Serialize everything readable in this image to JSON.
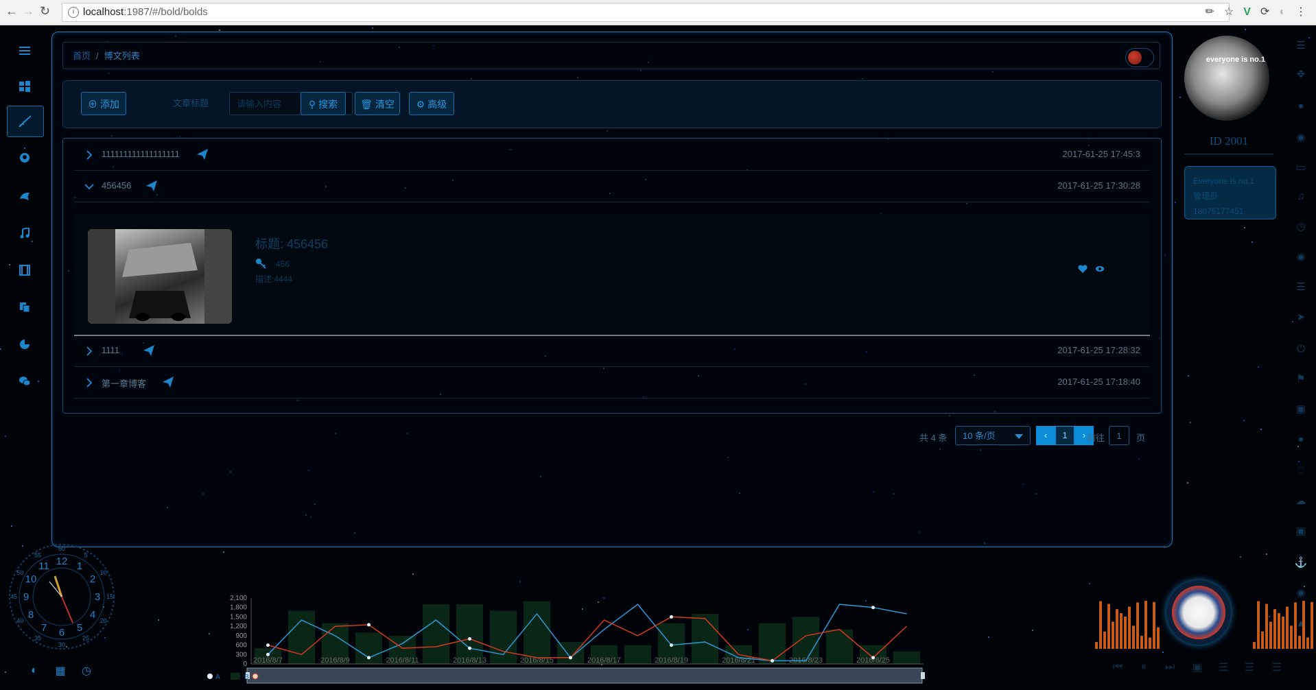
{
  "browser": {
    "url_host": "localhost",
    "url_rest": ":1987/#/bold/bolds"
  },
  "breadcrumb": {
    "home": "首页",
    "separator": "/",
    "current": "博文列表"
  },
  "toolbar": {
    "add_label": "添加",
    "field_label": "文章标题",
    "search_placeholder": "请输入内容",
    "search_label": "搜索",
    "clear_label": "清空",
    "advanced_label": "高级"
  },
  "posts": [
    {
      "title": "111111111111111111",
      "date": "2017-61-25 17:45:3",
      "expanded": false
    },
    {
      "title": "456456",
      "date": "2017-61-25 17:30:28",
      "expanded": true
    },
    {
      "title": "1111",
      "date": "2017-61-25 17:28:32",
      "expanded": false
    },
    {
      "title": "第一章博客",
      "date": "2017-61-25 17:18:40",
      "expanded": false
    }
  ],
  "detail": {
    "title": "标题: 456456",
    "tag": "456",
    "desc": "描述:4444"
  },
  "pagination": {
    "total": "共 4 条",
    "page_size": "10 条/页",
    "current_page": "1",
    "goto_label": "前往",
    "goto_value": "1",
    "page_unit": "页"
  },
  "profile": {
    "avatar_brand": "everyone is no.1",
    "id": "ID 2001",
    "motto": "Everyone is no.1",
    "role": "管理员",
    "phone": "18075177451"
  },
  "clock": {
    "center_digits": "12",
    "hour_numerals": [
      "12",
      "1",
      "2",
      "3",
      "4",
      "5",
      "6",
      "7",
      "8",
      "9",
      "10",
      "11"
    ],
    "minute_numerals": [
      "60",
      "5",
      "10",
      "15",
      "20",
      "25",
      "30",
      "35",
      "40",
      "45",
      "50",
      "55"
    ]
  },
  "colors": {
    "accent": "#1b86cc",
    "series_a": "#2a9ad8",
    "series_b": "#d8391c",
    "bars": "#0b2a1a"
  },
  "chart_data": {
    "type": "line",
    "categories": [
      "2016/8/7",
      "2016/8/8",
      "2016/8/9",
      "2016/8/10",
      "2016/8/11",
      "2016/8/12",
      "2016/8/13",
      "2016/8/14",
      "2016/8/15",
      "2016/8/16",
      "2016/8/17",
      "2016/8/18",
      "2016/8/19",
      "2016/8/20",
      "2016/8/21",
      "2016/8/22",
      "2016/8/23",
      "2016/8/24",
      "2016/8/25",
      "2016/8/26"
    ],
    "tick_labels": [
      "2016/8/7",
      "2016/8/9",
      "2016/8/11",
      "2016/8/13",
      "2016/8/15",
      "2016/8/17",
      "2016/8/19",
      "2016/8/21",
      "2016/8/23",
      "2016/8/25"
    ],
    "yticks": [
      "2,100",
      "1,800",
      "1,500",
      "1,200",
      "900",
      "600",
      "300",
      "0"
    ],
    "ylim": [
      0,
      2100
    ],
    "series": [
      {
        "name": "A",
        "type": "line",
        "color": "#2a9ad8",
        "values": [
          300,
          1400,
          900,
          200,
          650,
          1400,
          500,
          300,
          1600,
          200,
          1100,
          1900,
          600,
          700,
          200,
          100,
          100,
          1900,
          1800,
          1600
        ]
      },
      {
        "name": "B",
        "type": "bar",
        "color": "#0b2a1a",
        "values": [
          500,
          1700,
          1300,
          1000,
          900,
          1900,
          1900,
          1700,
          2000,
          700,
          600,
          600,
          1300,
          1600,
          600,
          1300,
          1500,
          1100,
          600,
          400
        ]
      },
      {
        "name": "",
        "type": "line",
        "color": "#d8391c",
        "values": [
          600,
          300,
          1200,
          1250,
          500,
          550,
          800,
          400,
          200,
          200,
          1400,
          900,
          1500,
          1450,
          300,
          100,
          900,
          1100,
          200,
          1200
        ]
      }
    ],
    "legend": [
      "A",
      "B"
    ]
  }
}
